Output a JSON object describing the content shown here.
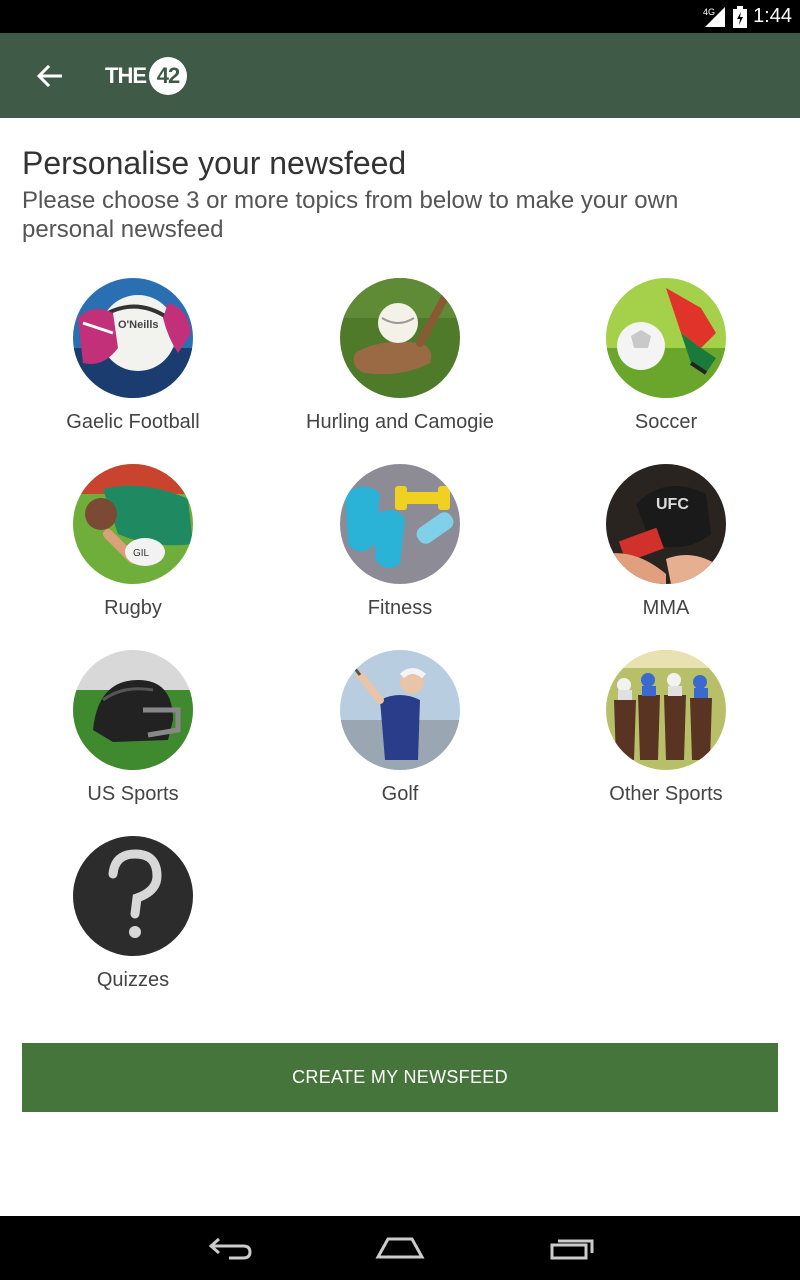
{
  "status_bar": {
    "network": "4G",
    "time": "1:44"
  },
  "app_bar": {
    "back_icon": "arrow-back-icon",
    "logo_text": "THE",
    "logo_number": "42",
    "colors": {
      "background": "#3f5a47"
    }
  },
  "header": {
    "title": "Personalise your newsfeed",
    "subtitle": "Please choose 3 or more topics from below to make your own personal newsfeed"
  },
  "topics": [
    {
      "label": "Gaelic Football",
      "icon": "gaelic-football-icon"
    },
    {
      "label": "Hurling and Camogie",
      "icon": "hurling-icon"
    },
    {
      "label": "Soccer",
      "icon": "soccer-icon"
    },
    {
      "label": "Rugby",
      "icon": "rugby-icon"
    },
    {
      "label": "Fitness",
      "icon": "fitness-icon"
    },
    {
      "label": "MMA",
      "icon": "mma-icon"
    },
    {
      "label": "US Sports",
      "icon": "us-sports-icon"
    },
    {
      "label": "Golf",
      "icon": "golf-icon"
    },
    {
      "label": "Other Sports",
      "icon": "horse-racing-icon"
    },
    {
      "label": "Quizzes",
      "icon": "question-mark-icon"
    }
  ],
  "cta": {
    "label": "CREATE MY NEWSFEED",
    "color": "#45753a"
  },
  "nav_bar": {
    "back": "nav-back-icon",
    "home": "nav-home-icon",
    "recents": "nav-recents-icon"
  }
}
